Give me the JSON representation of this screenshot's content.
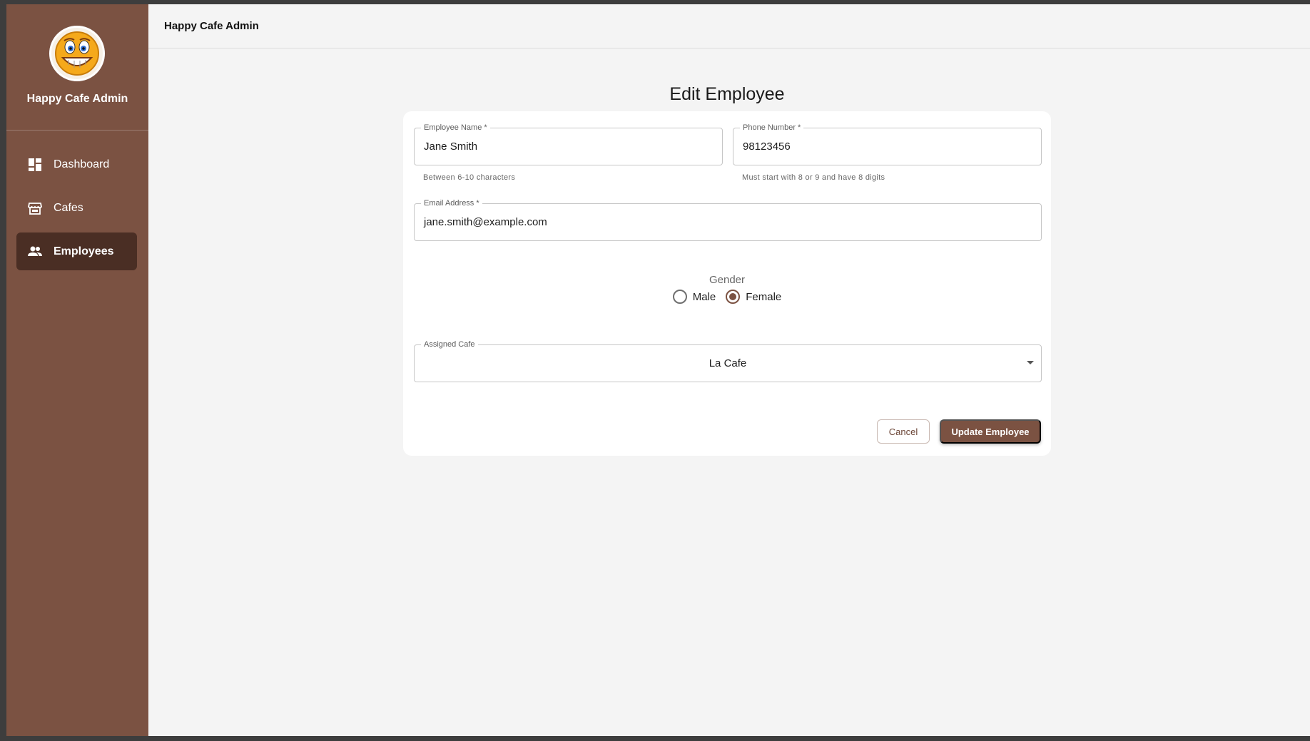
{
  "sidebar": {
    "app_name": "Happy Cafe Admin",
    "items": [
      {
        "label": "Dashboard",
        "icon": "dashboard-icon"
      },
      {
        "label": "Cafes",
        "icon": "store-icon"
      },
      {
        "label": "Employees",
        "icon": "people-icon",
        "active": true
      }
    ]
  },
  "header": {
    "title": "Happy Cafe Admin"
  },
  "form": {
    "title": "Edit Employee",
    "name": {
      "label": "Employee Name *",
      "value": "Jane Smith",
      "helper": "Between 6-10 characters"
    },
    "phone": {
      "label": "Phone Number *",
      "value": "98123456",
      "helper": "Must start with 8 or 9 and have 8 digits"
    },
    "email": {
      "label": "Email Address *",
      "value": "jane.smith@example.com"
    },
    "gender": {
      "label": "Gender",
      "options": [
        "Male",
        "Female"
      ],
      "selected": "Female"
    },
    "cafe": {
      "label": "Assigned Cafe",
      "value": "La Cafe"
    },
    "cancel_label": "Cancel",
    "submit_label": "Update Employee"
  },
  "colors": {
    "brand": "#7b5242",
    "brand_dark": "#4a2e24",
    "background": "#f4f4f4"
  }
}
